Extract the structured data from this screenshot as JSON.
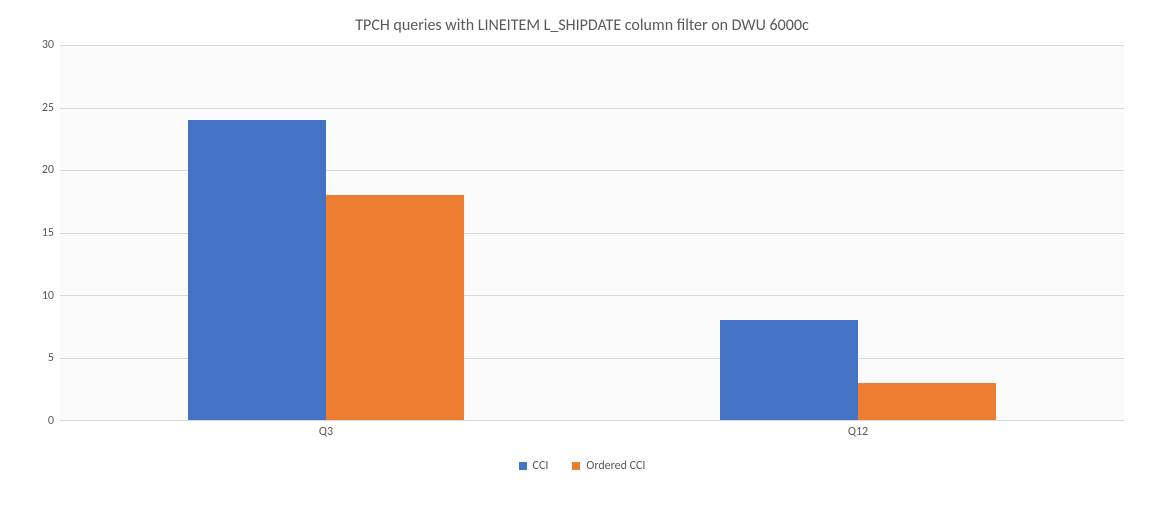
{
  "chart_data": {
    "type": "bar",
    "title": "TPCH queries with LINEITEM L_SHIPDATE column filter on DWU 6000c",
    "categories": [
      "Q3",
      "Q12"
    ],
    "series": [
      {
        "name": "CCI",
        "color": "#4472C4",
        "values": [
          24,
          8
        ]
      },
      {
        "name": "Ordered CCI",
        "color": "#ED7D31",
        "values": [
          18,
          3
        ]
      }
    ],
    "xlabel": "",
    "ylabel": "",
    "ylim": [
      0,
      30
    ],
    "y_ticks": [
      0,
      5,
      10,
      15,
      20,
      25,
      30
    ]
  }
}
